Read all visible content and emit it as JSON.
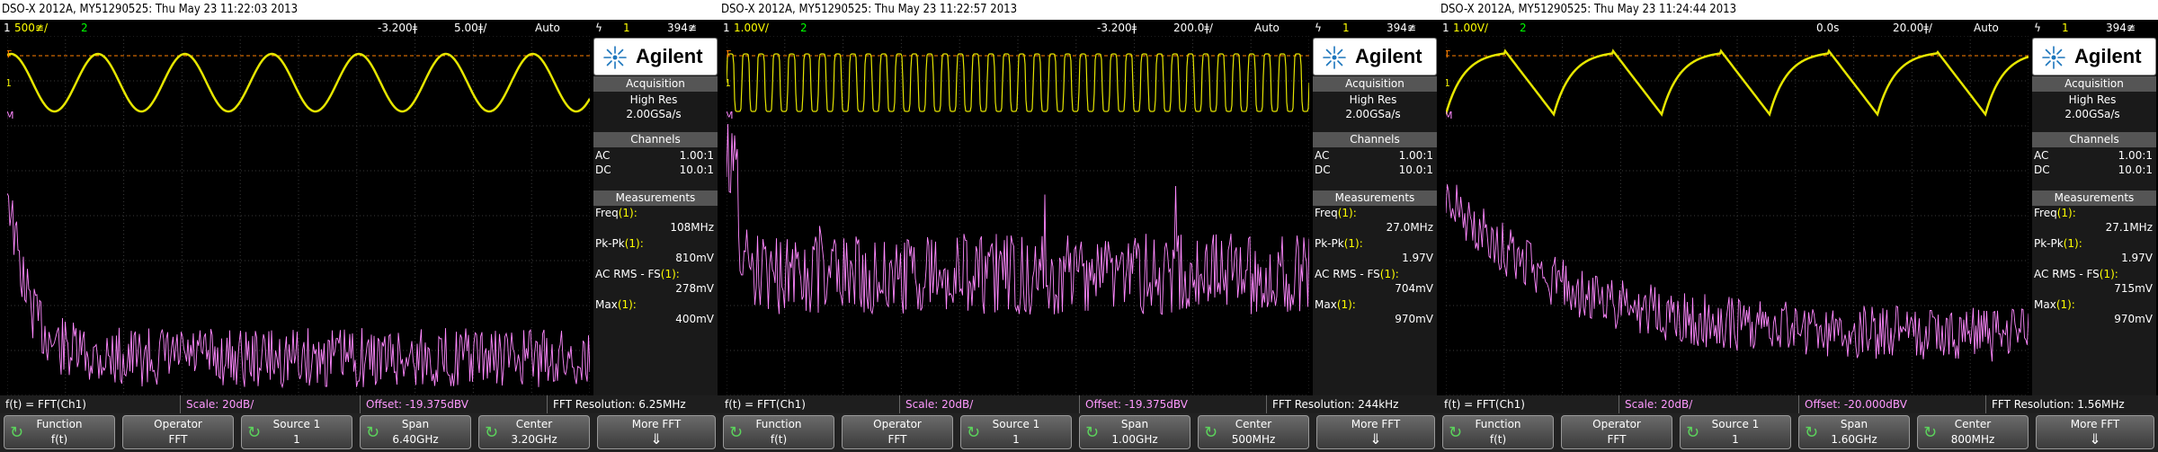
{
  "scopes": [
    {
      "title": "DSO-X 2012A, MY51290525: Thu May 23 11:22:03 2013",
      "status": {
        "ch1_num": "1",
        "ch1_scale": "500≇/",
        "ch2_num": "2",
        "delay": "-3.200ǂ",
        "timebase": "5.00ǂ/",
        "trigger_mode": "Auto",
        "trig_icon": "ϟ",
        "trig_src": "1",
        "trig_level": "394≇"
      },
      "waveform": {
        "cycles": 6.7,
        "shape": "sine",
        "amplitude": 0.5
      },
      "spectrum": {
        "decay": "fast",
        "noise": 0.22,
        "floor": 0.86
      },
      "panel": {
        "brand": "Agilent",
        "acquisition_head": "Acquisition",
        "acq_mode": "High Res",
        "sample_rate": "2.00GSa/s",
        "channels_head": "Channels",
        "ch1_coupling": "AC",
        "ch1_probe": "1.00:1",
        "ch2_coupling": "DC",
        "ch2_probe": "10.0:1",
        "measurements_head": "Measurements",
        "m1_label": "Freq",
        "m1_src": "(1):",
        "m1_value": "108MHz",
        "m2_label": "Pk-Pk",
        "m2_src": "(1):",
        "m2_value": "810mV",
        "m3_label": "AC RMS - FS",
        "m3_src": "(1):",
        "m3_value": "278mV",
        "m4_label": "Max",
        "m4_src": "(1):",
        "m4_value": "400mV"
      },
      "fft": {
        "func": "f(t) = FFT(Ch1)",
        "scale": "Scale: 20dB/",
        "offset": "Offset: -19.375dBV",
        "resolution": "FFT Resolution: 6.25MHz"
      },
      "softkeys": [
        {
          "label": "Function",
          "value": "f(t)"
        },
        {
          "label": "Operator",
          "value": "FFT"
        },
        {
          "label": "Source 1",
          "value": "1"
        },
        {
          "label": "Span",
          "value": "6.40GHz"
        },
        {
          "label": "Center",
          "value": "3.20GHz"
        },
        {
          "label": "More FFT",
          "value": "⇓"
        }
      ]
    },
    {
      "title": "DSO-X 2012A, MY51290525: Thu May 23 11:22:57 2013",
      "status": {
        "ch1_num": "1",
        "ch1_scale": "1.00V/",
        "ch2_num": "2",
        "delay": "-3.200ǂ",
        "timebase": "200.0ǂ/",
        "trigger_mode": "Auto",
        "trig_icon": "ϟ",
        "trig_src": "1",
        "trig_level": "394≇"
      },
      "waveform": {
        "cycles": 38,
        "shape": "square",
        "amplitude": 0.5
      },
      "spectrum": {
        "decay": "none",
        "noise": 0.3,
        "floor": 0.55
      },
      "panel": {
        "brand": "Agilent",
        "acquisition_head": "Acquisition",
        "acq_mode": "High Res",
        "sample_rate": "2.00GSa/s",
        "channels_head": "Channels",
        "ch1_coupling": "AC",
        "ch1_probe": "1.00:1",
        "ch2_coupling": "DC",
        "ch2_probe": "10.0:1",
        "measurements_head": "Measurements",
        "m1_label": "Freq",
        "m1_src": "(1):",
        "m1_value": "27.0MHz",
        "m2_label": "Pk-Pk",
        "m2_src": "(1):",
        "m2_value": "1.97V",
        "m3_label": "AC RMS - FS",
        "m3_src": "(1):",
        "m3_value": "704mV",
        "m4_label": "Max",
        "m4_src": "(1):",
        "m4_value": "970mV"
      },
      "fft": {
        "func": "f(t) = FFT(Ch1)",
        "scale": "Scale: 20dB/",
        "offset": "Offset: -19.375dBV",
        "resolution": "FFT Resolution: 244kHz"
      },
      "softkeys": [
        {
          "label": "Function",
          "value": "f(t)"
        },
        {
          "label": "Operator",
          "value": "FFT"
        },
        {
          "label": "Source 1",
          "value": "1"
        },
        {
          "label": "Span",
          "value": "1.00GHz"
        },
        {
          "label": "Center",
          "value": "500MHz"
        },
        {
          "label": "More FFT",
          "value": "⇓"
        }
      ]
    },
    {
      "title": "DSO-X 2012A, MY51290525: Thu May 23 11:24:44 2013",
      "status": {
        "ch1_num": "1",
        "ch1_scale": "1.00V/",
        "ch2_num": "2",
        "delay": "0.0s",
        "timebase": "20.00ǂ/",
        "trigger_mode": "Auto",
        "trig_icon": "ϟ",
        "trig_src": "1",
        "trig_level": "394≇"
      },
      "waveform": {
        "cycles": 5.4,
        "shape": "shark",
        "amplitude": 0.55
      },
      "spectrum": {
        "decay": "slow",
        "noise": 0.2,
        "floor": 0.78
      },
      "panel": {
        "brand": "Agilent",
        "acquisition_head": "Acquisition",
        "acq_mode": "High Res",
        "sample_rate": "2.00GSa/s",
        "channels_head": "Channels",
        "ch1_coupling": "AC",
        "ch1_probe": "1.00:1",
        "ch2_coupling": "DC",
        "ch2_probe": "10.0:1",
        "measurements_head": "Measurements",
        "m1_label": "Freq",
        "m1_src": "(1):",
        "m1_value": "27.1MHz",
        "m2_label": "Pk-Pk",
        "m2_src": "(1):",
        "m2_value": "1.97V",
        "m3_label": "AC RMS - FS",
        "m3_src": "(1):",
        "m3_value": "715mV",
        "m4_label": "Max",
        "m4_src": "(1):",
        "m4_value": "970mV"
      },
      "fft": {
        "func": "f(t) = FFT(Ch1)",
        "scale": "Scale: 20dB/",
        "offset": "Offset: -20.000dBV",
        "resolution": "FFT Resolution: 1.56MHz"
      },
      "softkeys": [
        {
          "label": "Function",
          "value": "f(t)"
        },
        {
          "label": "Operator",
          "value": "FFT"
        },
        {
          "label": "Source 1",
          "value": "1"
        },
        {
          "label": "Span",
          "value": "1.60GHz"
        },
        {
          "label": "Center",
          "value": "800MHz"
        },
        {
          "label": "More FFT",
          "value": "⇓"
        }
      ]
    }
  ],
  "colors": {
    "ch1": "#e6e600",
    "math": "#ff88ff",
    "grid": "#3a3a3a",
    "trigger_line": "#ff8000"
  }
}
